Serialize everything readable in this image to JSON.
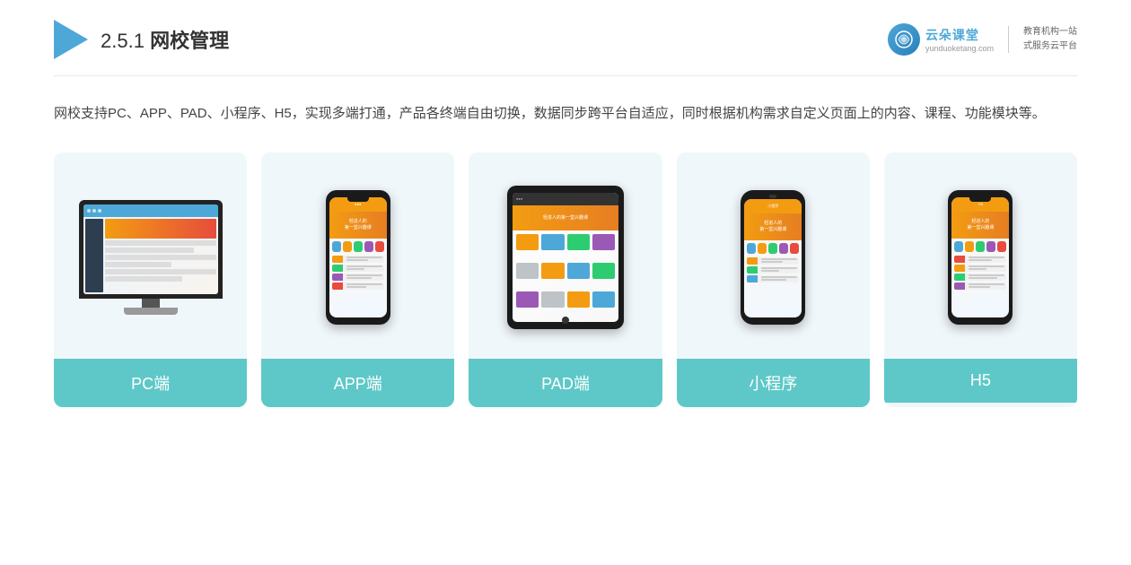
{
  "header": {
    "section_number": "2.5.1",
    "title_normal": "网校管理",
    "brand": {
      "name": "云朵课堂",
      "url": "yunduoketang.com",
      "tagline_line1": "教育机构一站",
      "tagline_line2": "式服务云平台"
    }
  },
  "description": {
    "text": "网校支持PC、APP、PAD、小程序、H5，实现多端打通，产品各终端自由切换，数据同步跨平台自适应，同时根据机构需求自定义页面上的内容、课程、功能模块等。"
  },
  "cards": [
    {
      "id": "pc",
      "label": "PC端"
    },
    {
      "id": "app",
      "label": "APP端"
    },
    {
      "id": "pad",
      "label": "PAD端"
    },
    {
      "id": "miniprogram",
      "label": "小程序"
    },
    {
      "id": "h5",
      "label": "H5"
    }
  ]
}
